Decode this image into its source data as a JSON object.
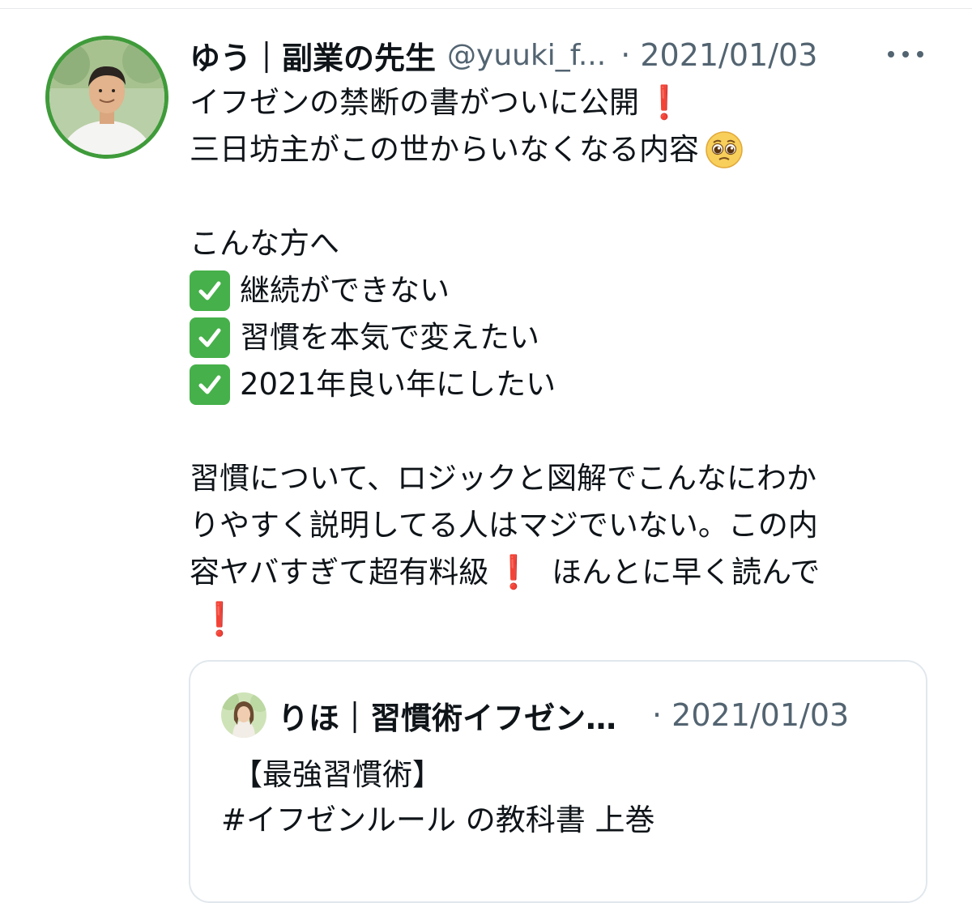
{
  "tweet": {
    "display_name": "ゆう｜副業の先生",
    "handle": "@yuuki_f...",
    "timestamp": "· 2021/01/03",
    "body": {
      "line1": "イフゼンの禁断の書がついに公開",
      "line2": "三日坊主がこの世からいなくなる内容",
      "line3": "こんな方へ",
      "checklist": [
        "継続ができない",
        "習慣を本気で変えたい",
        "2021年良い年にしたい"
      ],
      "paragraph_line1": "習慣について、ロジックと図解でこんなにわか",
      "paragraph_line2": "りやすく説明してる人はマジでいない。この内",
      "paragraph_line3a": "容ヤバすぎて超有料級",
      "paragraph_line3b": "ほんとに早く読んで",
      "exclaim": "❗"
    },
    "icons": {
      "exclaim": "red-exclamation-icon",
      "check": "check-mark-button-icon",
      "pleading": "pleading-face-icon",
      "more": "more-options-icon"
    },
    "colors": {
      "avatar_ring": "#3f9b3a",
      "muted": "#536471",
      "exclaim": "#e0242c",
      "check": "#46b04a"
    }
  },
  "quote": {
    "display_name": "りほ｜習慣術イフゼン…",
    "timestamp": "· 2021/01/03",
    "line1": "【最強習慣術】",
    "line2": "#イフゼンルール の教科書 上巻"
  }
}
